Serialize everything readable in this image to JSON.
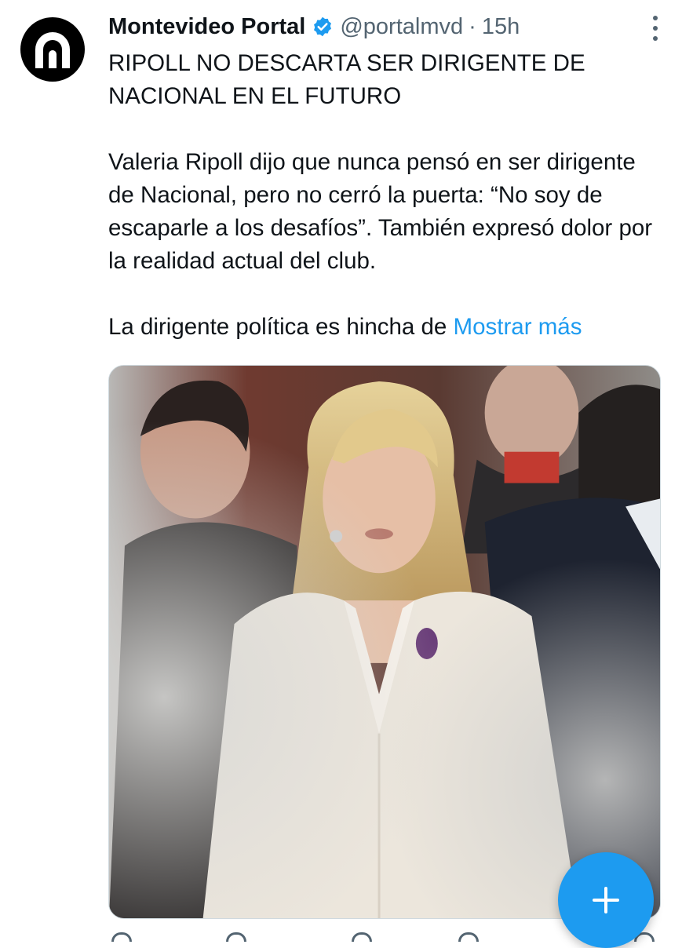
{
  "tweet": {
    "display_name": "Montevideo Portal",
    "handle": "@portalmvd",
    "separator": "·",
    "time": "15h",
    "headline": "RIPOLL NO DESCARTA SER DIRIGENTE DE NACIONAL EN EL FUTURO",
    "paragraph": "Valeria Ripoll dijo que nunca pensó en ser dirigente de Nacional, pero no cerró la puerta: “No soy de escaparle a los desafíos”. También expresó dolor por la realidad actual del club.",
    "truncated_line": "La dirigente política es hincha de ",
    "show_more": "Mostrar más"
  },
  "icons": {
    "avatar": "portal-logo",
    "verified": "verified-badge-icon",
    "more": "more-options-icon",
    "fab": "compose-plus-icon",
    "actions": [
      "reply-icon",
      "retweet-icon",
      "like-icon",
      "views-icon",
      "share-icon"
    ]
  },
  "colors": {
    "accent": "#1d9bf0",
    "text": "#0f1419",
    "secondary": "#536471",
    "avatar_bg": "#000000"
  }
}
